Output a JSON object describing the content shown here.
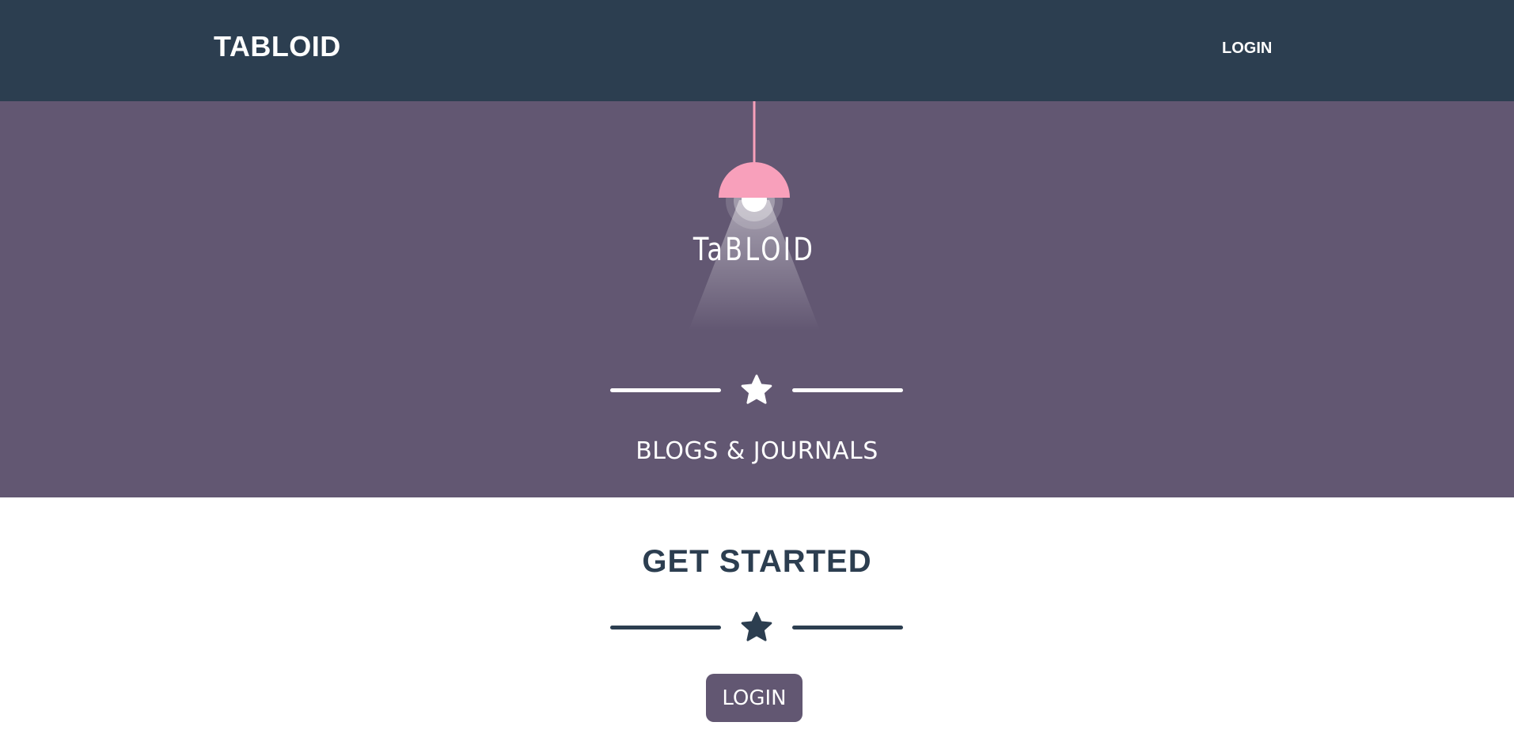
{
  "navbar": {
    "brand": "TABLOID",
    "login_label": "LOGIN"
  },
  "masthead": {
    "logo_text": "TaBLOID",
    "subheading": "BLOGS & JOURNALS"
  },
  "get_started": {
    "title": "GET STARTED",
    "login_button_label": "LOGIN"
  },
  "colors": {
    "navbar_bg": "#2c3e50",
    "masthead_bg": "#625772",
    "lamp_shade": "#f8a0bb",
    "button_bg": "#625772",
    "text_dark": "#2c3e50"
  },
  "icons": {
    "divider_icon": "star-icon",
    "hero_image": "hanging-lamp-icon"
  }
}
